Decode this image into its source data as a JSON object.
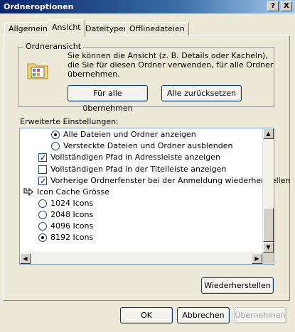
{
  "window": {
    "title": "Ordneroptionen",
    "help_btn": "?",
    "close_btn": "X"
  },
  "tabs": [
    {
      "label": "Allgemein"
    },
    {
      "label": "Ansicht"
    },
    {
      "label": "Dateitypen"
    },
    {
      "label": "Offlinedateien"
    }
  ],
  "folder_view": {
    "title": "Ordneransicht",
    "description": "Sie können die Ansicht (z. B. Details oder Kacheln), die Sie für diesen Ordner verwenden, für alle Ordner übernehmen.",
    "apply_all": "Für alle übernehmen",
    "reset_all": "Alle zurücksetzen"
  },
  "advanced": {
    "label": "Erweiterte Einstellungen:",
    "items": [
      {
        "type": "radio",
        "checked": true,
        "label": "Alle Dateien und Ordner anzeigen"
      },
      {
        "type": "radio",
        "checked": false,
        "label": "Versteckte Dateien und Ordner ausblenden"
      },
      {
        "type": "check",
        "checked": true,
        "label": "Vollständigen Pfad in Adressleiste anzeigen"
      },
      {
        "type": "check",
        "checked": false,
        "label": "Vollständigen Pfad in der Titelleiste anzeigen"
      },
      {
        "type": "check",
        "checked": true,
        "label": "Vorherige Ordnerfenster bei der Anmeldung wiederherstellen"
      },
      {
        "type": "group",
        "label": "Icon Cache Grösse"
      },
      {
        "type": "radio",
        "checked": false,
        "label": "1024 Icons"
      },
      {
        "type": "radio",
        "checked": false,
        "label": "2048 Icons"
      },
      {
        "type": "radio",
        "checked": false,
        "label": "4096 Icons"
      },
      {
        "type": "radio",
        "checked": true,
        "label": "8192 Icons"
      }
    ],
    "restore_defaults": "Wiederherstellen"
  },
  "footer": {
    "ok": "OK",
    "cancel": "Abbrechen",
    "apply": "Übernehmen"
  }
}
